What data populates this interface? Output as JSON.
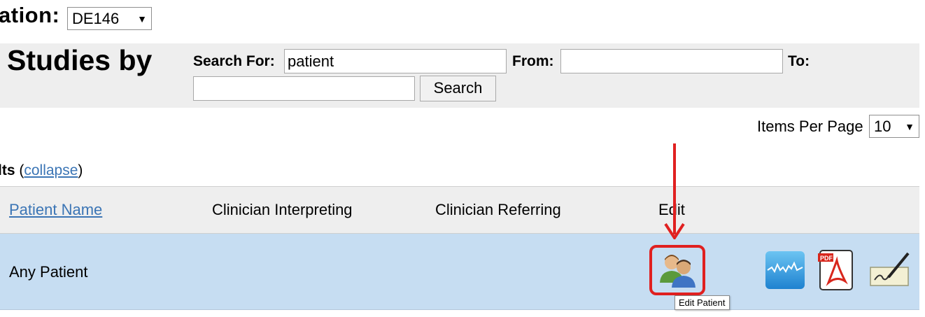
{
  "location": {
    "label": "ation:",
    "selected": "DE146"
  },
  "search": {
    "title": "Studies by",
    "search_for_label": "Search For:",
    "search_for_value": "patient",
    "from_label": "From:",
    "from_value": "",
    "to_label": "To:",
    "to_value": "",
    "search_button": "Search"
  },
  "paging": {
    "items_per_page_label": "Items Per Page",
    "items_per_page_value": "10"
  },
  "results": {
    "prefix": "lts",
    "open_paren": "(",
    "collapse_link": "collapse",
    "close_paren": ")"
  },
  "table": {
    "headers": [
      "Patient Name",
      "Clinician Interpreting",
      "Clinician Referring",
      "Edit"
    ],
    "rows": [
      {
        "patient_name": "Any Patient",
        "clinician_interpreting": "",
        "clinician_referring": ""
      }
    ]
  },
  "tooltip": "Edit Patient",
  "icons": {
    "edit_patient": "edit-patient-icon",
    "waveform": "waveform-icon",
    "pdf": "pdf-icon",
    "sign": "sign-icon"
  },
  "colors": {
    "row_highlight": "#c6ddf2",
    "header_bg": "#eeeeee",
    "link": "#3b75b5",
    "annotation_red": "#e02020"
  }
}
